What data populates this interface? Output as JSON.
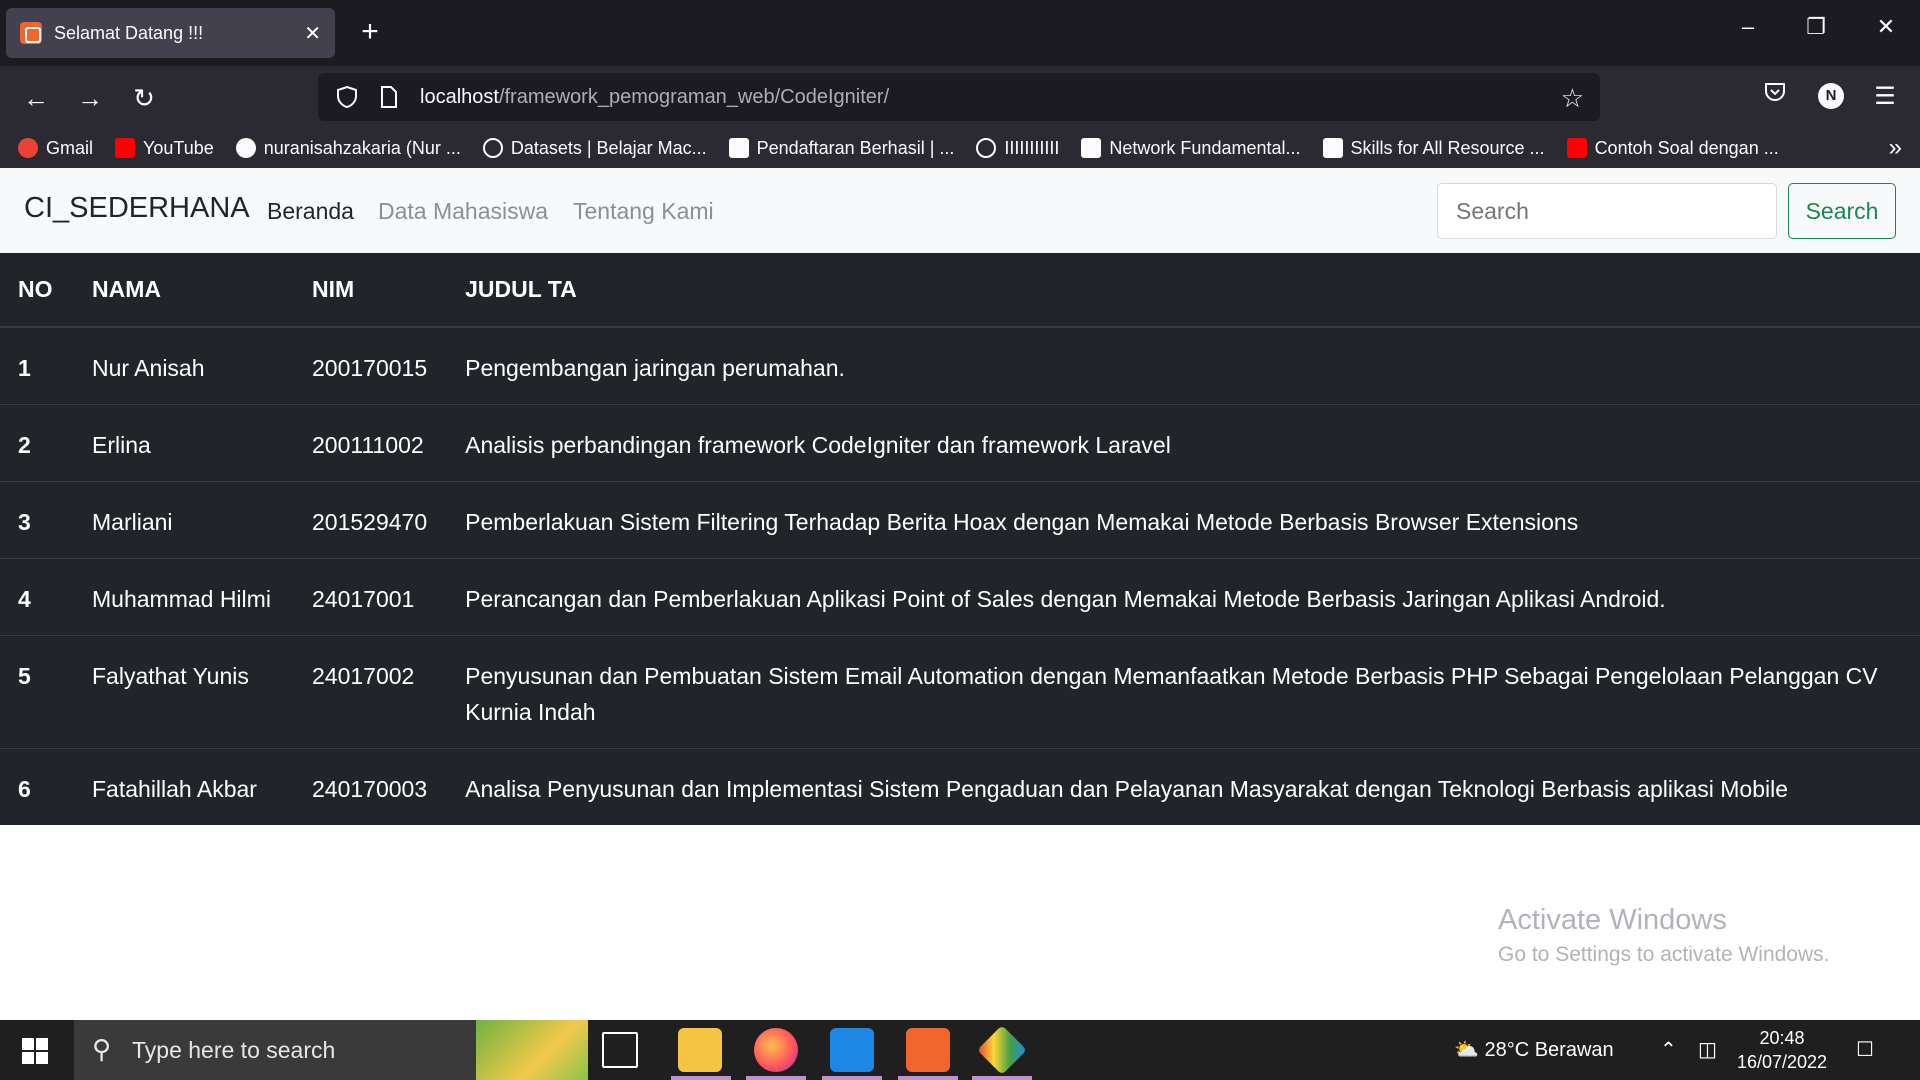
{
  "browser": {
    "tab_title": "Selamat Datang !!!",
    "tab_close": "✕",
    "new_tab": "+",
    "url_host": "localhost",
    "url_path": "/framework_pemograman_web/CodeIgniter/",
    "profile_initial": "N",
    "bookmarks": [
      {
        "label": "Gmail",
        "color": "#ea4335"
      },
      {
        "label": "YouTube",
        "color": "#ff0000"
      },
      {
        "label": "nuranisahzakaria (Nur ...",
        "color": "#ffffff"
      },
      {
        "label": "Datasets | Belajar Mac...",
        "color": "#2b2a33"
      },
      {
        "label": "Pendaftaran Berhasil | ...",
        "color": "#ffffff"
      },
      {
        "label": "IIIIIIIIIII",
        "color": "#2b2a33"
      },
      {
        "label": "Network Fundamental...",
        "color": "#ffffff"
      },
      {
        "label": "Skills for All Resource ...",
        "color": "#ffffff"
      },
      {
        "label": "Contoh Soal dengan ...",
        "color": "#ff0000"
      }
    ]
  },
  "site": {
    "brand": "CI_SEDERHANA",
    "nav": [
      {
        "label": "Beranda",
        "active": true
      },
      {
        "label": "Data Mahasiswa",
        "active": false
      },
      {
        "label": "Tentang Kami",
        "active": false
      }
    ],
    "search_placeholder": "Search",
    "search_button": "Search"
  },
  "table": {
    "headers": [
      "NO",
      "NAMA",
      "NIM",
      "JUDUL TA"
    ],
    "rows": [
      {
        "no": "1",
        "nama": "Nur Anisah",
        "nim": "200170015",
        "judul": "Pengembangan jaringan perumahan."
      },
      {
        "no": "2",
        "nama": "Erlina",
        "nim": "200111002",
        "judul": "Analisis perbandingan framework CodeIgniter dan framework Laravel"
      },
      {
        "no": "3",
        "nama": "Marliani",
        "nim": "201529470",
        "judul": "Pemberlakuan Sistem Filtering Terhadap Berita Hoax dengan Memakai Metode Berbasis Browser Extensions"
      },
      {
        "no": "4",
        "nama": "Muhammad Hilmi",
        "nim": "24017001",
        "judul": "Perancangan dan Pemberlakuan Aplikasi Point of Sales dengan Memakai Metode Berbasis Jaringan Aplikasi Android."
      },
      {
        "no": "5",
        "nama": "Falyathat Yunis",
        "nim": "24017002",
        "judul": "Penyusunan dan Pembuatan Sistem Email Automation dengan Memanfaatkan Metode Berbasis PHP Sebagai Pengelolaan Pelanggan CV Kurnia Indah"
      },
      {
        "no": "6",
        "nama": "Fatahillah Akbar",
        "nim": "240170003",
        "judul": "Analisa Penyusunan dan Implementasi Sistem Pengaduan dan Pelayanan Masyarakat dengan Teknologi Berbasis aplikasi Mobile"
      }
    ]
  },
  "watermark": {
    "line1": "Activate Windows",
    "line2": "Go to Settings to activate Windows."
  },
  "taskbar": {
    "search_placeholder": "Type here to search",
    "weather": "28°C  Berawan",
    "time": "20:48",
    "date": "16/07/2022"
  }
}
